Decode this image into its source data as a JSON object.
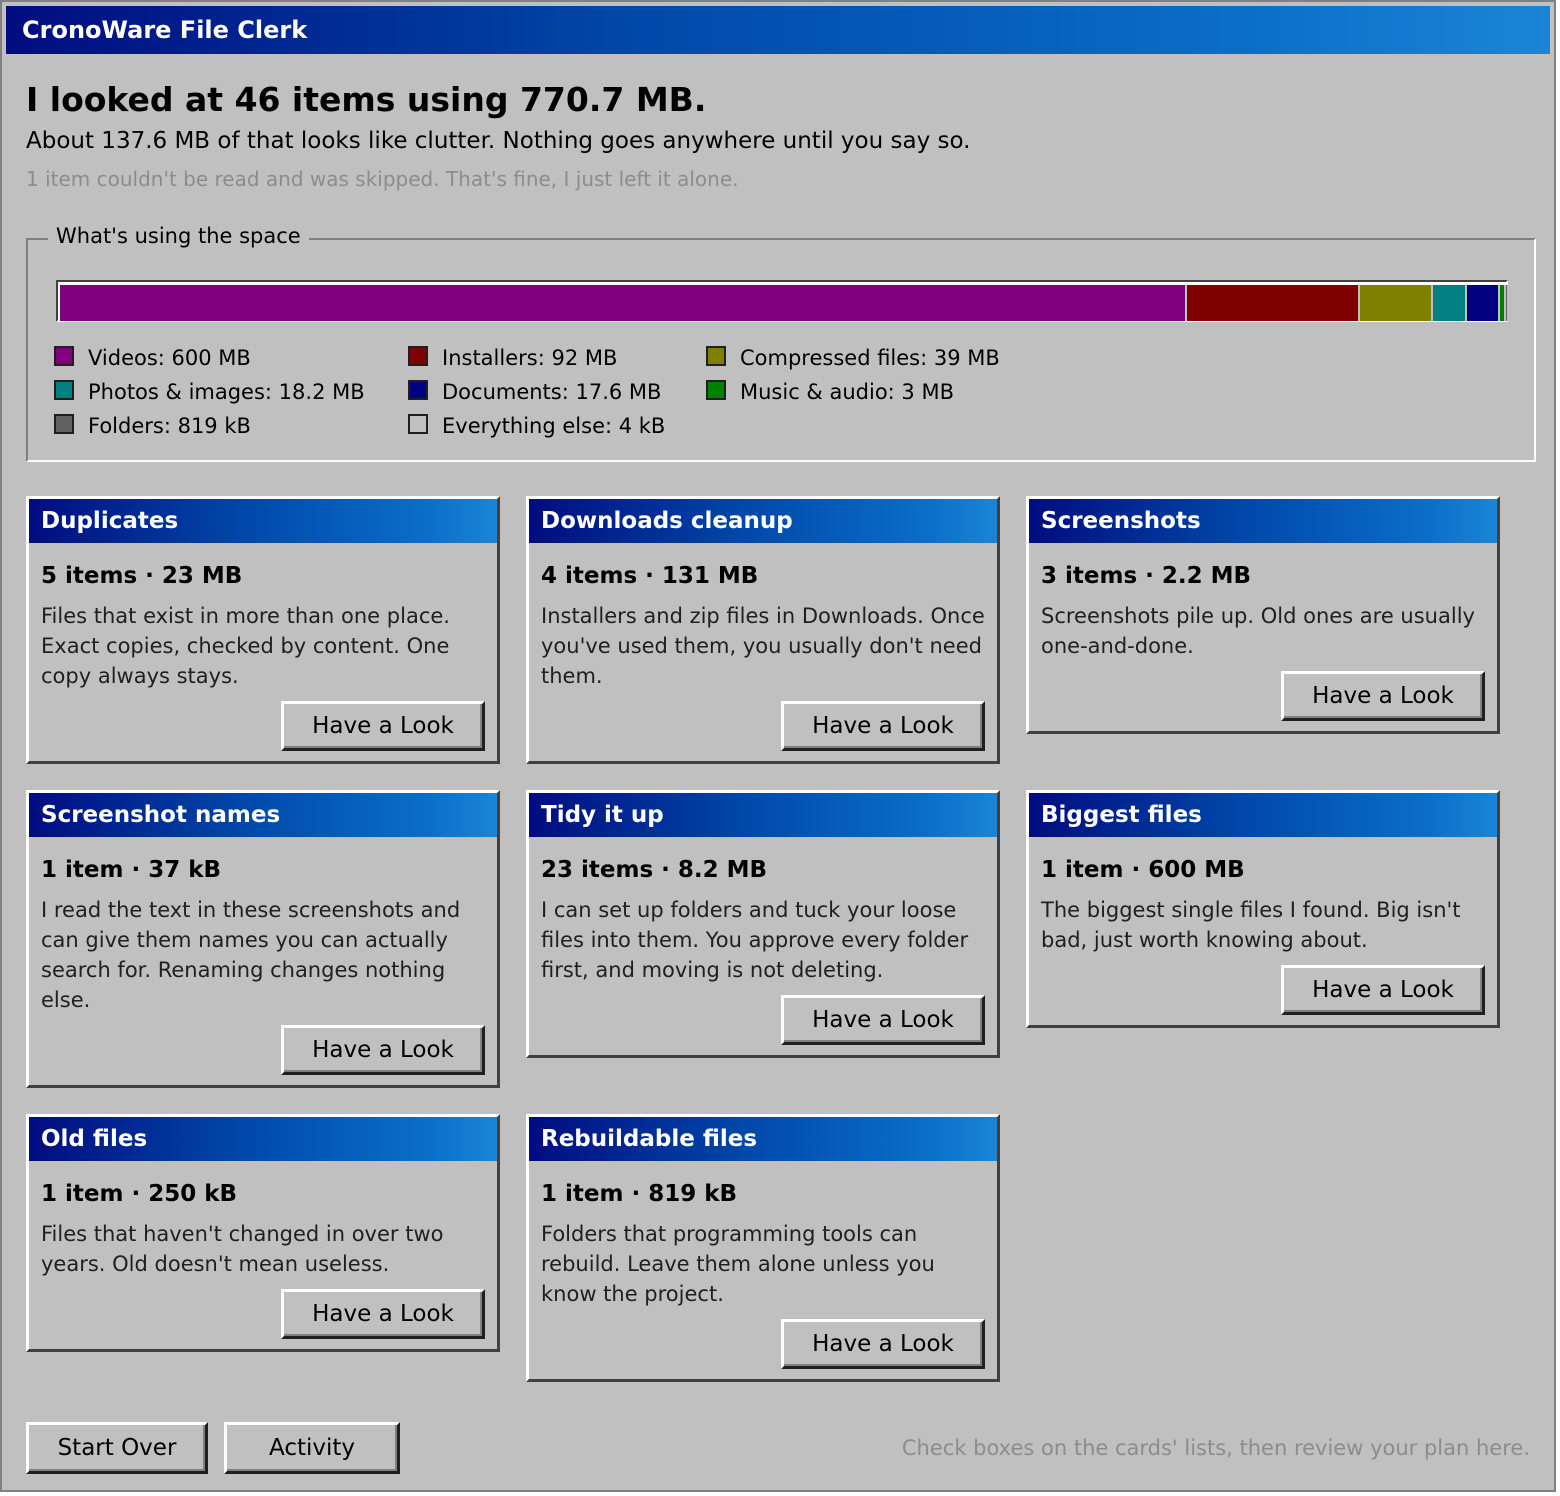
{
  "window": {
    "title": "CronoWare File Clerk"
  },
  "summary": {
    "headline": "I looked at 46 items using 770.7 MB.",
    "subline": "About 137.6 MB of that looks like clutter. Nothing goes anywhere until you say so.",
    "skipped": "1 item couldn't be read and was skipped. That's fine, I just left it alone."
  },
  "space": {
    "title": "What's using the space",
    "total_mb": 770.7,
    "categories": [
      {
        "label": "Videos: 600 MB",
        "mb": 600,
        "color": "#800080"
      },
      {
        "label": "Installers: 92 MB",
        "mb": 92,
        "color": "#800000"
      },
      {
        "label": "Compressed files: 39 MB",
        "mb": 39,
        "color": "#808000"
      },
      {
        "label": "Photos & images: 18.2 MB",
        "mb": 18.2,
        "color": "#008080"
      },
      {
        "label": "Documents: 17.6 MB",
        "mb": 17.6,
        "color": "#000080"
      },
      {
        "label": "Music & audio: 3 MB",
        "mb": 3,
        "color": "#008000"
      },
      {
        "label": "Folders: 819 kB",
        "mb": 0.819,
        "color": "#606060"
      },
      {
        "label": "Everything else: 4 kB",
        "mb": 0.004,
        "color": "#c0c0c0"
      }
    ]
  },
  "cards": [
    {
      "title": "Duplicates",
      "stats": "5 items · 23 MB",
      "desc": "Files that exist in more than one place. Exact copies, checked by content. One copy always stays.",
      "button": "Have a Look"
    },
    {
      "title": "Downloads cleanup",
      "stats": "4 items · 131 MB",
      "desc": "Installers and zip files in Downloads. Once you've used them, you usually don't need them.",
      "button": "Have a Look"
    },
    {
      "title": "Screenshots",
      "stats": "3 items · 2.2 MB",
      "desc": "Screenshots pile up. Old ones are usually one-and-done.",
      "button": "Have a Look"
    },
    {
      "title": "Screenshot names",
      "stats": "1 item · 37 kB",
      "desc": "I read the text in these screenshots and can give them names you can actually search for. Renaming changes nothing else.",
      "button": "Have a Look"
    },
    {
      "title": "Tidy it up",
      "stats": "23 items · 8.2 MB",
      "desc": "I can set up folders and tuck your loose files into them. You approve every folder first, and moving is not deleting.",
      "button": "Have a Look"
    },
    {
      "title": "Biggest files",
      "stats": "1 item · 600 MB",
      "desc": "The biggest single files I found. Big isn't bad, just worth knowing about.",
      "button": "Have a Look"
    },
    {
      "title": "Old files",
      "stats": "1 item · 250 kB",
      "desc": "Files that haven't changed in over two years. Old doesn't mean useless.",
      "button": "Have a Look"
    },
    {
      "title": "Rebuildable files",
      "stats": "1 item · 819 kB",
      "desc": "Folders that programming tools can rebuild. Leave them alone unless you know the project.",
      "button": "Have a Look"
    }
  ],
  "footer": {
    "start_over": "Start Over",
    "activity": "Activity",
    "hint": "Check boxes on the cards' lists, then review your plan here."
  }
}
